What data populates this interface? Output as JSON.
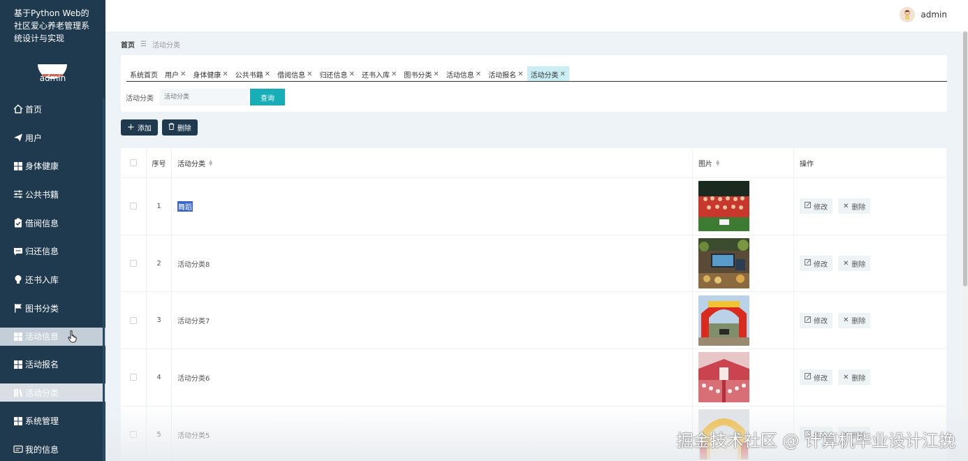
{
  "app": {
    "title": "基于Python Web的社区爱心养老管理系统设计与实现",
    "sidebar_user": "admin"
  },
  "sidebar": {
    "items": [
      {
        "label": "首页",
        "icon": "home-icon"
      },
      {
        "label": "用户",
        "icon": "paper-plane-icon"
      },
      {
        "label": "身体健康",
        "icon": "grid-icon"
      },
      {
        "label": "公共书籍",
        "icon": "sliders-icon"
      },
      {
        "label": "借阅信息",
        "icon": "clipboard-check-icon"
      },
      {
        "label": "归还信息",
        "icon": "chat-icon"
      },
      {
        "label": "还书入库",
        "icon": "lightbulb-icon"
      },
      {
        "label": "图书分类",
        "icon": "flag-icon"
      },
      {
        "label": "活动信息",
        "icon": "grid-icon"
      },
      {
        "label": "活动报名",
        "icon": "grid-icon"
      },
      {
        "label": "活动分类",
        "icon": "books-icon"
      },
      {
        "label": "系统管理",
        "icon": "grid-icon"
      },
      {
        "label": "我的信息",
        "icon": "id-card-icon"
      }
    ]
  },
  "topbar": {
    "user": "admin"
  },
  "breadcrumb": {
    "home": "首页",
    "separator": "☰",
    "current": "活动分类"
  },
  "tabs": [
    {
      "label": "系统首页",
      "closable": false
    },
    {
      "label": "用户",
      "closable": true
    },
    {
      "label": "身体健康",
      "closable": true
    },
    {
      "label": "公共书籍",
      "closable": true
    },
    {
      "label": "借阅信息",
      "closable": true
    },
    {
      "label": "归还信息",
      "closable": true
    },
    {
      "label": "还书入库",
      "closable": true
    },
    {
      "label": "图书分类",
      "closable": true
    },
    {
      "label": "活动信息",
      "closable": true
    },
    {
      "label": "活动报名",
      "closable": true
    },
    {
      "label": "活动分类",
      "closable": true,
      "active": true
    }
  ],
  "search": {
    "label": "活动分类",
    "placeholder": "活动分类",
    "button": "查询"
  },
  "actions": {
    "add": "添加",
    "delete": "删除"
  },
  "table": {
    "headers": {
      "index": "序号",
      "name": "活动分类",
      "image": "图片",
      "operations": "操作"
    },
    "edit_label": "修改",
    "delete_label": "删除",
    "rows": [
      {
        "index": "1",
        "name": "舞蹈",
        "selected_text": true,
        "image": "team-photo"
      },
      {
        "index": "2",
        "name": "活动分类8",
        "image": "event-hall-photo"
      },
      {
        "index": "3",
        "name": "活动分类7",
        "image": "red-arch-photo"
      },
      {
        "index": "4",
        "name": "活动分类6",
        "image": "wedding-tent-photo"
      },
      {
        "index": "5",
        "name": "活动分类5",
        "image": "inflatable-arch-photo"
      }
    ]
  },
  "watermark": "掘金技术社区 @ 计算机毕业设计江挽",
  "colors": {
    "sidebar_bg": "#1f3a4f",
    "accent": "#17aeb8",
    "active_tab": "#c9eef3",
    "selection": "#3a66c9"
  }
}
